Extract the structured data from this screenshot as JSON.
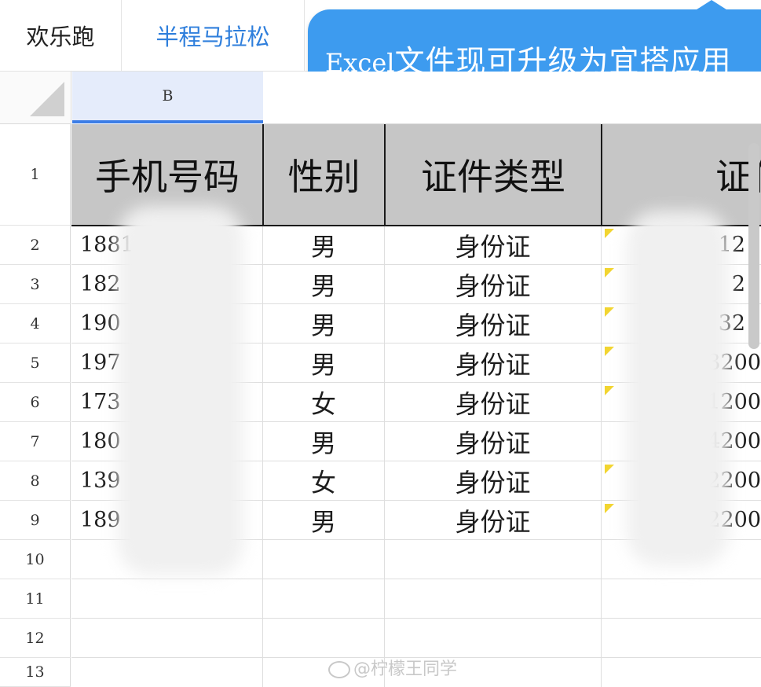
{
  "tabs": [
    "欢乐跑",
    "半程马拉松"
  ],
  "tooltip": {
    "latin": "Excel",
    "rest": "文件现可升级为宜搭应用"
  },
  "column_header": "B",
  "row_numbers": [
    "1",
    "2",
    "3",
    "4",
    "5",
    "6",
    "7",
    "8",
    "9",
    "10",
    "11",
    "12",
    "13"
  ],
  "table": {
    "headers": [
      "手机号码",
      "性别",
      "证件类型",
      "证件"
    ],
    "rows": [
      {
        "phone": "1881",
        "gender": "男",
        "id_type": "身份证",
        "id_tail": "12"
      },
      {
        "phone": "182",
        "gender": "男",
        "id_type": "身份证",
        "id_tail": "2"
      },
      {
        "phone": "190",
        "gender": "男",
        "id_type": "身份证",
        "id_tail": "32"
      },
      {
        "phone": "197",
        "gender": "男",
        "id_type": "身份证",
        "id_tail": "3200"
      },
      {
        "phone": "173",
        "gender": "女",
        "id_type": "身份证",
        "id_tail": "1200"
      },
      {
        "phone": "180",
        "gender": "男",
        "id_type": "身份证",
        "id_tail": "4200"
      },
      {
        "phone": "139",
        "gender": "女",
        "id_type": "身份证",
        "id_tail": "2200"
      },
      {
        "phone": "189",
        "gender": "男",
        "id_type": "身份证",
        "id_tail": "2200"
      }
    ]
  },
  "watermark": "@柠檬王同学",
  "colors": {
    "accent": "#3c7de6",
    "tooltip_bg": "#3d9bef",
    "header_fill": "#c6c6c6",
    "comment_flag": "#f2d530"
  }
}
